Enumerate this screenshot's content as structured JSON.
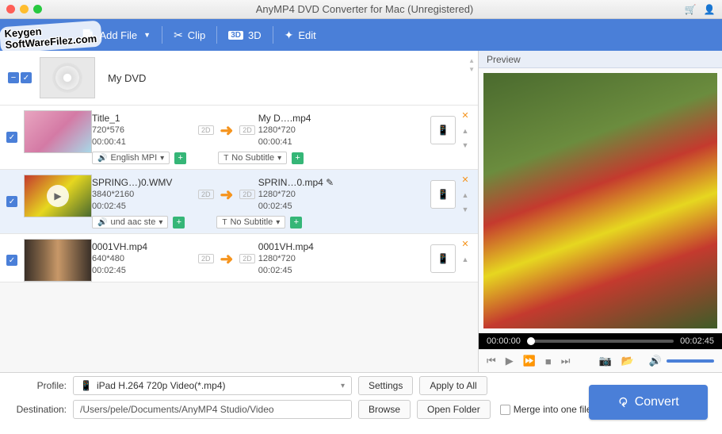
{
  "titlebar": {
    "title": "AnyMP4 DVD Converter for Mac (Unregistered)"
  },
  "watermark": {
    "line1": "Keygen",
    "line2": "SoftWareFilez.com"
  },
  "toolbar": {
    "add_file": "Add File",
    "clip": "Clip",
    "three_d": "3D",
    "edit": "Edit"
  },
  "dvd": {
    "name": "My DVD"
  },
  "items": [
    {
      "src_name": "Title_1",
      "src_res": "720*576",
      "src_dur": "00:00:41",
      "dst_name": "My D….mp4",
      "dst_res": "1280*720",
      "dst_dur": "00:00:41",
      "audio": "English MPI",
      "subtitle": "No Subtitle"
    },
    {
      "src_name": "SPRING…)0.WMV",
      "src_res": "3840*2160",
      "src_dur": "00:02:45",
      "dst_name": "SPRIN…0.mp4",
      "dst_res": "1280*720",
      "dst_dur": "00:02:45",
      "audio": "und aac ste",
      "subtitle": "No Subtitle"
    },
    {
      "src_name": "0001VH.mp4",
      "src_res": "640*480",
      "src_dur": "00:02:45",
      "dst_name": "0001VH.mp4",
      "dst_res": "1280*720",
      "dst_dur": "00:02:45",
      "audio": "",
      "subtitle": ""
    }
  ],
  "preview": {
    "header": "Preview",
    "time_cur": "00:00:00",
    "time_total": "00:02:45"
  },
  "bottom": {
    "profile_label": "Profile:",
    "profile_value": "iPad H.264 720p Video(*.mp4)",
    "settings": "Settings",
    "apply_all": "Apply to All",
    "dest_label": "Destination:",
    "dest_value": "/Users/pele/Documents/AnyMP4 Studio/Video",
    "browse": "Browse",
    "open_folder": "Open Folder",
    "merge": "Merge into one file",
    "convert": "Convert"
  },
  "labels": {
    "dim2d": "2D",
    "subtitle_prefix": "T",
    "audio_prefix": "🔊"
  }
}
